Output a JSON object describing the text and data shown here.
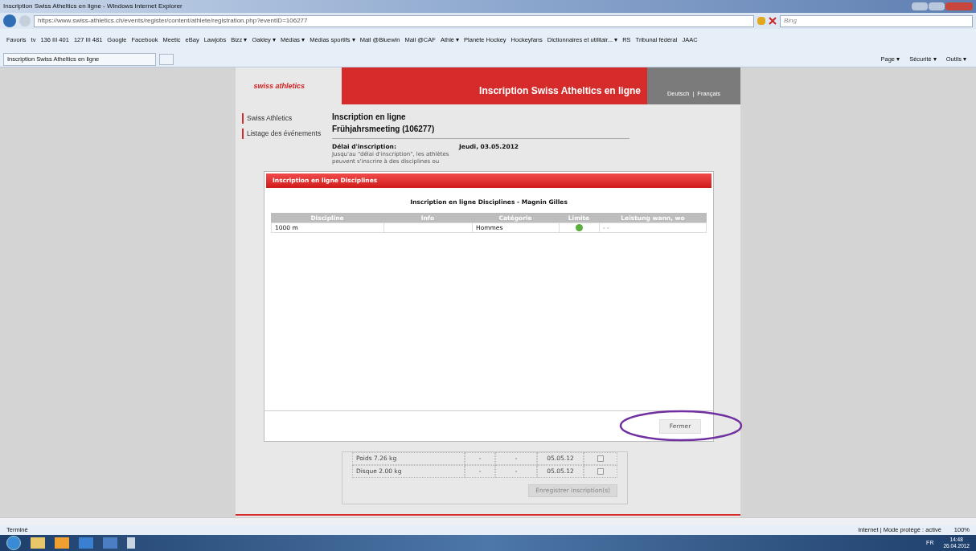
{
  "window": {
    "title": "Inscription Swiss Atheltics en ligne - Windows Internet Explorer"
  },
  "address_bar": {
    "url": "https://www.swiss-athletics.ch/events/register/content/athlete/registration.php?eventID=106277",
    "search_placeholder": "Bing"
  },
  "favorites": [
    "Favoris",
    "tv",
    "136 III 401",
    "127 III 481",
    "Google",
    "Facebook",
    "Meetic",
    "eBay",
    "Lawjobs",
    "Bizz ▾",
    "Oakley ▾",
    "Médias ▾",
    "Médias sportifs ▾",
    "Mail @Bluewin",
    "Mail @CAF",
    "Athlé ▾",
    "Planète Hockey",
    "Hockeyfans",
    "Dictionnaires et utilitair... ▾",
    "RS",
    "Tribunal fédéral",
    "JAAC"
  ],
  "tab": {
    "title": "Inscription Swiss Atheltics en ligne"
  },
  "command_bar": [
    "Page ▾",
    "Sécurité ▾",
    "Outils ▾"
  ],
  "site": {
    "logo_text": "swiss athletics",
    "banner_title": "Inscription Swiss Atheltics en ligne",
    "languages": [
      "Deutsch",
      "Français"
    ],
    "language_separator": "|",
    "nav": [
      {
        "label": "Swiss Athletics"
      },
      {
        "label": "Listage des événements"
      }
    ],
    "heading": "Inscription en ligne",
    "event": "Frühjahrsmeeting (106277)",
    "deadline_label": "Délai d'inscription:",
    "deadline_value": "Jeudi, 03.05.2012",
    "deadline_note": "Jusqu'au \"délai d'inscription\", les athlètes peuvent s'inscrire à des disciplines ou",
    "rows": [
      {
        "discipline": "Poids 7.26 kg",
        "c2": "-",
        "c3": "-",
        "date": "05.05.12",
        "checked": false
      },
      {
        "discipline": "Disque 2.00 kg",
        "c2": "-",
        "c3": "-",
        "date": "05.05.12",
        "checked": false
      }
    ],
    "save_button": "Enregistrer inscription(s)"
  },
  "dialog": {
    "title": "Inscription en ligne Disciplines",
    "subtitle": "Inscription en ligne Disciplines - Magnin Gilles",
    "columns": [
      "Discipline",
      "Info",
      "Catégorie",
      "Limite",
      "Leistung wann, wo"
    ],
    "rows": [
      {
        "discipline": "1000 m",
        "info": "",
        "category": "Hommes",
        "limit_ok": true,
        "performance": "- -"
      }
    ],
    "close_button": "Fermer"
  },
  "status_bar": {
    "text": "Terminé",
    "zone": "Internet | Mode protégé : activé",
    "zoom": "100%"
  },
  "taskbar": {
    "lang": "FR",
    "time": "14:48",
    "date": "26.04.2012"
  }
}
